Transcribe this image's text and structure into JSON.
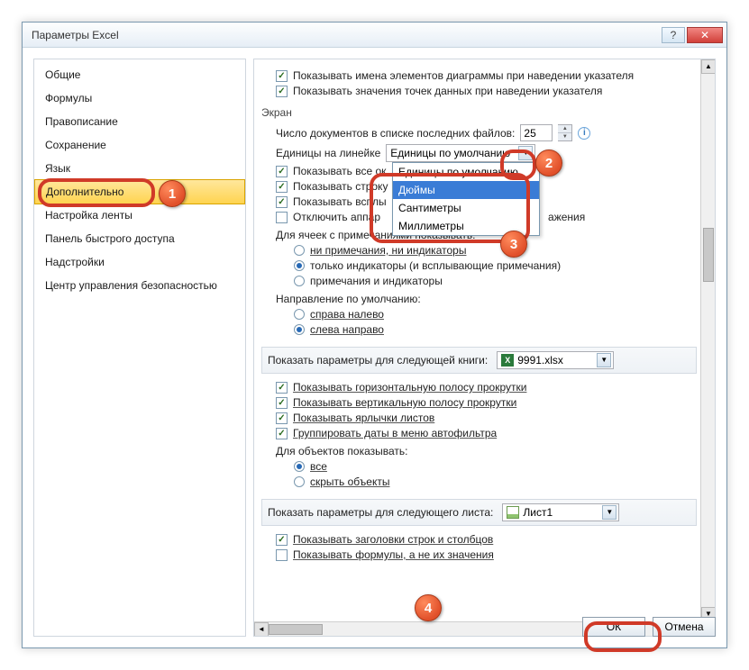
{
  "window": {
    "title": "Параметры Excel",
    "help_icon": "?",
    "close_icon": "✕"
  },
  "sidebar": {
    "items": [
      {
        "label": "Общие"
      },
      {
        "label": "Формулы"
      },
      {
        "label": "Правописание"
      },
      {
        "label": "Сохранение"
      },
      {
        "label": "Язык"
      },
      {
        "label": "Дополнительно"
      },
      {
        "label": "Настройка ленты"
      },
      {
        "label": "Панель быстрого доступа"
      },
      {
        "label": "Надстройки"
      },
      {
        "label": "Центр управления безопасностью"
      }
    ]
  },
  "content": {
    "top_checks": [
      "Показывать имена элементов диаграммы при наведении указателя",
      "Показывать значения точек данных при наведении указателя"
    ],
    "screen_header": "Экран",
    "recent_docs_label": "Число документов в списке последних файлов:",
    "recent_docs_value": "25",
    "ruler_label": "Единицы на линейке",
    "ruler_value": "Единицы по умолчанию",
    "ruler_options": [
      "Единицы по умолчанию",
      "Дюймы",
      "Сантиметры",
      "Миллиметры"
    ],
    "mid_checks": [
      "Показывать все ок",
      "Показывать строку",
      "Показывать всплы"
    ],
    "hw_accel": "Отключить аппар",
    "hw_accel_suffix": "ажения",
    "comments_header": "Для ячеек с примечаниями показывать:",
    "comments_opts": [
      "ни примечания, ни индикаторы",
      "только индикаторы (и всплывающие примечания)",
      "примечания и индикаторы"
    ],
    "direction_header": "Направление по умолчанию:",
    "direction_opts": [
      "справа налево",
      "слева направо"
    ],
    "book_section": "Показать параметры для следующей книги:",
    "book_value": "9991.xlsx",
    "book_checks": [
      "Показывать горизонтальную полосу прокрутки",
      "Показывать вертикальную полосу прокрутки",
      "Показывать ярлычки листов",
      "Группировать даты в меню автофильтра"
    ],
    "objects_header": "Для объектов показывать:",
    "objects_opts": [
      "все",
      "скрыть объекты"
    ],
    "sheet_section": "Показать параметры для следующего листа:",
    "sheet_value": "Лист1",
    "sheet_checks": [
      "Показывать заголовки строк и столбцов",
      "Показывать формулы, а не их значения"
    ]
  },
  "buttons": {
    "ok": "ОК",
    "cancel": "Отмена"
  },
  "badges": {
    "b1": "1",
    "b2": "2",
    "b3": "3",
    "b4": "4"
  }
}
